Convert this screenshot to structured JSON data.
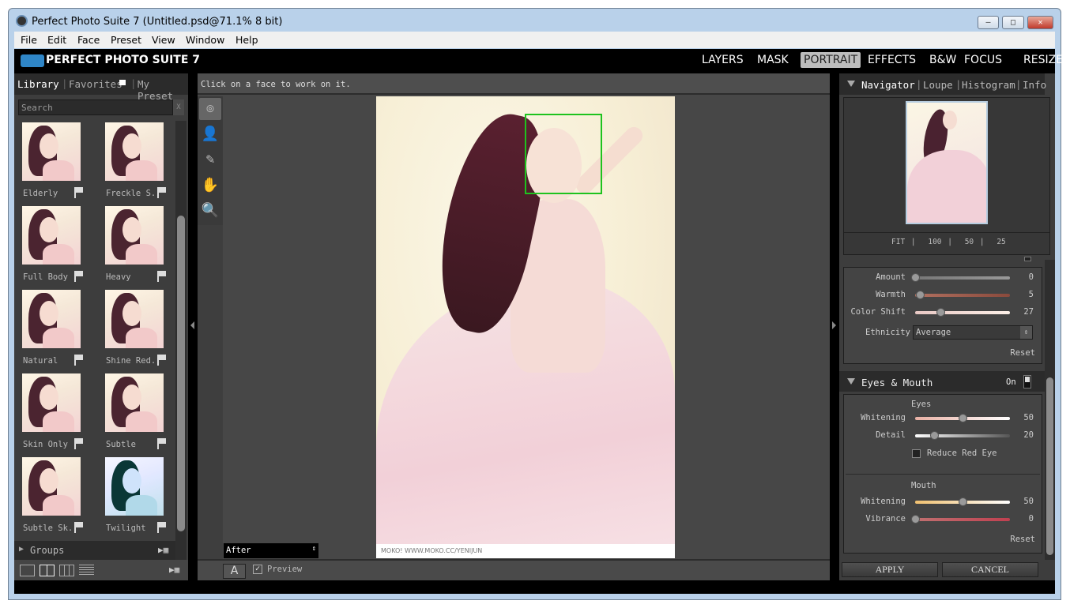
{
  "window": {
    "title": "Perfect Photo Suite 7 (Untitled.psd@71.1% 8 bit)",
    "controls": [
      "minimize",
      "maximize",
      "close"
    ]
  },
  "menu": [
    "File",
    "Edit",
    "Face",
    "Preset",
    "View",
    "Window",
    "Help"
  ],
  "app": {
    "logo_text": "PERFECT PHOTO SUITE 7",
    "modules": [
      "LAYERS",
      "MASK",
      "PORTRAIT",
      "EFFECTS",
      "B&W",
      "FOCUS",
      "RESIZE"
    ],
    "active_module": "PORTRAIT"
  },
  "library": {
    "tabs": [
      "Library",
      "Favorites",
      "My Preset"
    ],
    "search_placeholder": "Search",
    "search_clear": "X",
    "presets": [
      {
        "label": "Elderly"
      },
      {
        "label": "Freckle S.."
      },
      {
        "label": "Full Body"
      },
      {
        "label": "Heavy"
      },
      {
        "label": "Natural"
      },
      {
        "label": "Shine Red.."
      },
      {
        "label": "Skin Only"
      },
      {
        "label": "Subtle"
      },
      {
        "label": "Subtle Sk.."
      },
      {
        "label": "Twilight"
      }
    ],
    "groups_label": "Groups"
  },
  "canvas": {
    "hint": "Click on a face to work on it.",
    "caption": "MOKO! WWW.MOKO.CC/YENIJUN",
    "view_select": "After",
    "a_button": "A",
    "preview_label": "Preview",
    "preview_checked": true,
    "zoom": "71.1%"
  },
  "navigator": {
    "tabs": [
      "Navigator",
      "Loupe",
      "Histogram",
      "Info"
    ],
    "zoom_options": [
      "FIT",
      "100",
      "50",
      "25"
    ]
  },
  "skin": {
    "sliders": [
      {
        "label": "Amount",
        "value": 0,
        "max": 100,
        "track": "#888888"
      },
      {
        "label": "Warmth",
        "value": 5,
        "max": 100,
        "track": "#9a5a4a"
      },
      {
        "label": "Color Shift",
        "value": 27,
        "max": 100,
        "track": "#f0dcd8"
      }
    ],
    "ethnicity_label": "Ethnicity",
    "ethnicity_value": "Average",
    "reset": "Reset"
  },
  "eyes_mouth": {
    "title": "Eyes & Mouth",
    "toggle_label": "On",
    "eyes_heading": "Eyes",
    "eyes_sliders": [
      {
        "label": "Whitening",
        "value": 50,
        "max": 100
      },
      {
        "label": "Detail",
        "value": 20,
        "max": 100
      }
    ],
    "reduce_red_eye": "Reduce Red Eye",
    "reduce_red_eye_checked": false,
    "mouth_heading": "Mouth",
    "mouth_sliders": [
      {
        "label": "Whitening",
        "value": 50,
        "max": 100
      },
      {
        "label": "Vibrance",
        "value": 0,
        "max": 100
      }
    ],
    "reset": "Reset"
  },
  "actions": {
    "apply": "APPLY",
    "cancel": "CANCEL"
  }
}
